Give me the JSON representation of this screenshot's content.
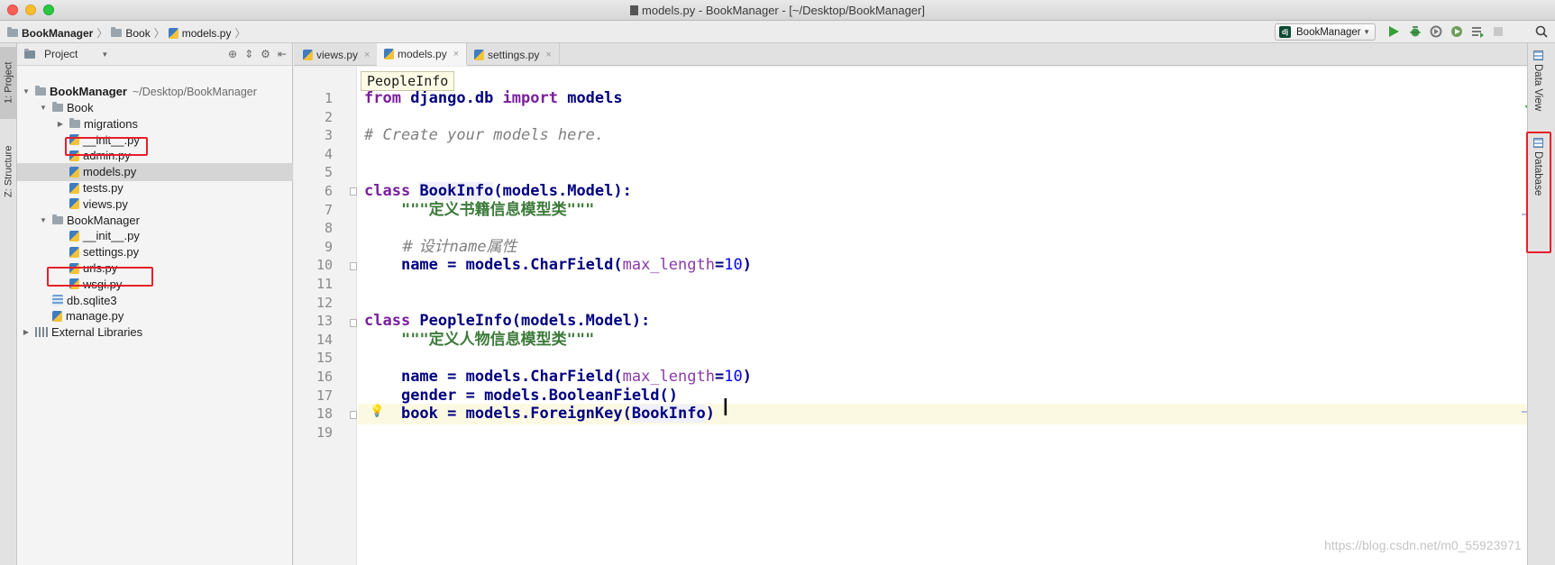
{
  "window": {
    "title": "models.py - BookManager - [~/Desktop/BookManager]"
  },
  "breadcrumb": [
    "BookManager",
    "Book",
    "models.py"
  ],
  "toolbar": {
    "run_config": "BookManager"
  },
  "left_stripe": {
    "project": "1: Project",
    "structure": "Z: Structure"
  },
  "project_panel": {
    "header": "Project",
    "tree": [
      {
        "label": "BookManager",
        "note": "~/Desktop/BookManager",
        "kind": "folder",
        "depth": 0,
        "expanded": true
      },
      {
        "label": "Book",
        "kind": "folder",
        "depth": 1,
        "expanded": true
      },
      {
        "label": "migrations",
        "kind": "folder",
        "depth": 2,
        "expanded": false
      },
      {
        "label": "__init__.py",
        "kind": "py",
        "depth": 2
      },
      {
        "label": "admin.py",
        "kind": "py",
        "depth": 2
      },
      {
        "label": "models.py",
        "kind": "py",
        "depth": 2,
        "selected": true
      },
      {
        "label": "tests.py",
        "kind": "py",
        "depth": 2
      },
      {
        "label": "views.py",
        "kind": "py",
        "depth": 2
      },
      {
        "label": "BookManager",
        "kind": "folder",
        "depth": 1,
        "expanded": true
      },
      {
        "label": "__init__.py",
        "kind": "py",
        "depth": 2
      },
      {
        "label": "settings.py",
        "kind": "py",
        "depth": 2
      },
      {
        "label": "urls.py",
        "kind": "py",
        "depth": 2
      },
      {
        "label": "wsgi.py",
        "kind": "py",
        "depth": 2
      },
      {
        "label": "db.sqlite3",
        "kind": "db",
        "depth": 1
      },
      {
        "label": "manage.py",
        "kind": "py",
        "depth": 1
      },
      {
        "label": "External Libraries",
        "kind": "lib",
        "depth": 0,
        "expanded": false
      }
    ]
  },
  "editor": {
    "tabs": [
      {
        "label": "views.py",
        "active": false
      },
      {
        "label": "models.py",
        "active": true
      },
      {
        "label": "settings.py",
        "active": false
      }
    ],
    "tooltip": "PeopleInfo",
    "current_line": 18,
    "line_numbers": [
      "1",
      "2",
      "3",
      "4",
      "5",
      "6",
      "7",
      "8",
      "9",
      "10",
      "11",
      "12",
      "13",
      "14",
      "15",
      "16",
      "17",
      "18",
      "19"
    ],
    "lines": [
      [
        {
          "t": "from",
          "c": "kw"
        },
        {
          "t": " django.db ",
          "c": "kw2"
        },
        {
          "t": "import",
          "c": "kw"
        },
        {
          "t": " models",
          "c": "kw2"
        }
      ],
      [],
      [
        {
          "t": "# Create your models here.",
          "c": "cmt"
        }
      ],
      [],
      [],
      [
        {
          "t": "class",
          "c": "kw"
        },
        {
          "t": " "
        },
        {
          "t": "BookInfo",
          "c": "kw2 cls-hl"
        },
        {
          "t": "(models.Model):",
          "c": "kw2"
        }
      ],
      [
        {
          "t": "    "
        },
        {
          "t": "\"\"\"",
          "c": "str"
        },
        {
          "t": "定义书籍信息模型类",
          "c": "str cjk"
        },
        {
          "t": "\"\"\"",
          "c": "str"
        }
      ],
      [],
      [
        {
          "t": "    "
        },
        {
          "t": "# 设计",
          "c": "cmt cjk"
        },
        {
          "t": "name",
          "c": "cmt"
        },
        {
          "t": "属性",
          "c": "cmt cjk"
        }
      ],
      [
        {
          "t": "    "
        },
        {
          "t": "name = models.CharField(",
          "c": "kw2"
        },
        {
          "t": "max_length",
          "c": "param"
        },
        {
          "t": "=",
          "c": "kw2"
        },
        {
          "t": "10",
          "c": "num"
        },
        {
          "t": ")",
          "c": "kw2"
        }
      ],
      [],
      [],
      [
        {
          "t": "class",
          "c": "kw"
        },
        {
          "t": " PeopleInfo(models.Model):",
          "c": "kw2"
        }
      ],
      [
        {
          "t": "    "
        },
        {
          "t": "\"\"\"",
          "c": "str"
        },
        {
          "t": "定义人物信息模型类",
          "c": "str cjk"
        },
        {
          "t": "\"\"\"",
          "c": "str"
        }
      ],
      [],
      [
        {
          "t": "    "
        },
        {
          "t": "name = models.CharField(",
          "c": "kw2"
        },
        {
          "t": "max_length",
          "c": "param"
        },
        {
          "t": "=",
          "c": "kw2"
        },
        {
          "t": "10",
          "c": "num"
        },
        {
          "t": ")",
          "c": "kw2"
        }
      ],
      [
        {
          "t": "    "
        },
        {
          "t": "gender = models.BooleanField()",
          "c": "kw2"
        }
      ],
      [
        {
          "t": "    "
        },
        {
          "t": "book = models.ForeignKey(",
          "c": "kw2"
        },
        {
          "t": "BookInfo",
          "c": "kw2 cls-hl"
        },
        {
          "t": ")",
          "c": "kw2"
        }
      ],
      []
    ]
  },
  "right_stripe": {
    "data_view": "Data View",
    "database": "Database"
  },
  "watermark": "https://blog.csdn.net/m0_55923971",
  "colors": {
    "highlight_box": "#e5202a",
    "selection": "#d5d5d5",
    "current_line": "#fcf9e2"
  }
}
